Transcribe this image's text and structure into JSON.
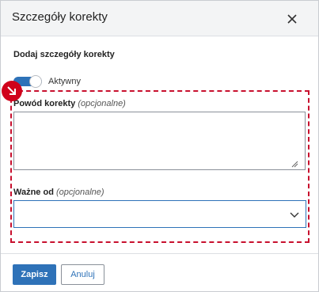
{
  "dialog": {
    "title": "Szczegóły korekty",
    "close_icon": "close-icon"
  },
  "form": {
    "section_title": "Dodaj szczegóły korekty",
    "toggle": {
      "label": "Aktywny",
      "on": true
    },
    "reason": {
      "label": "Powód korekty",
      "optional": "(opcjonalne)",
      "value": ""
    },
    "valid_from": {
      "label": "Ważne od",
      "optional": "(opcjonalne)",
      "value": ""
    }
  },
  "buttons": {
    "save": "Zapisz",
    "cancel": "Anuluj"
  },
  "colors": {
    "accent": "#2e72b8",
    "highlight": "#c8102e"
  }
}
